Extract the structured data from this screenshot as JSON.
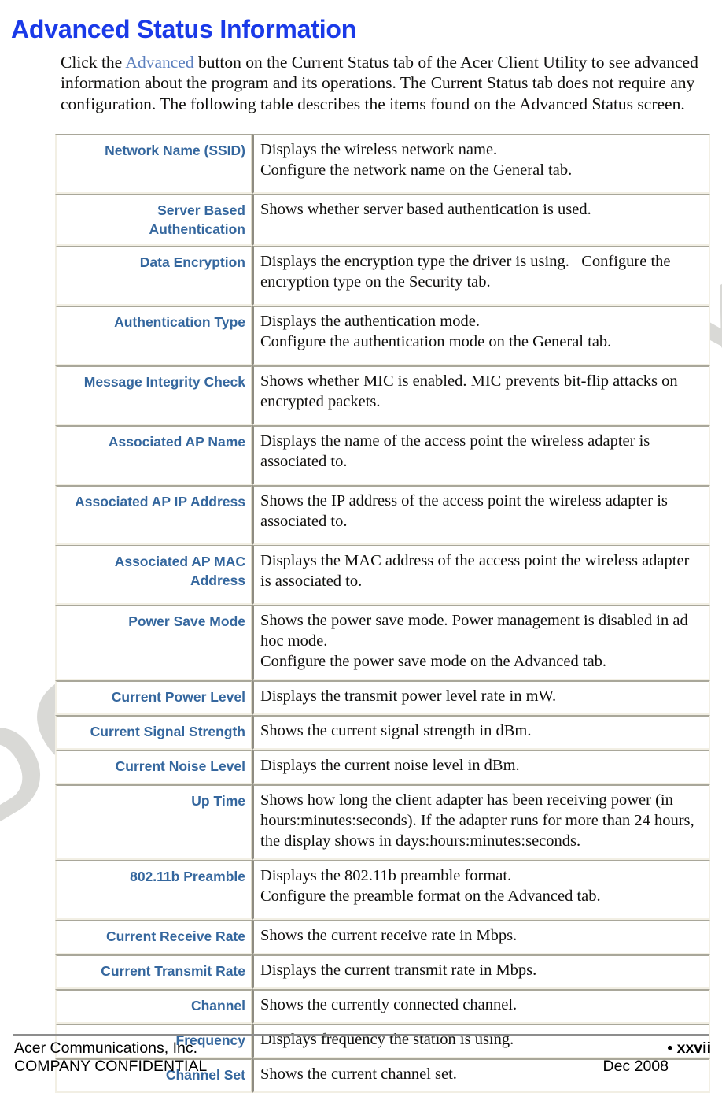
{
  "document": {
    "title": "Advanced Status Information",
    "watermark": "DO NOT COPY",
    "heading_color": "#1a3ae8",
    "label_color": "#35679e",
    "link_color": "#5b7fbe"
  },
  "intro": {
    "before_link": "Click the ",
    "link_text": "Advanced",
    "after_link": " button on the Current Status tab of the Acer Client Utility to see advanced information about the program and its operations. The Current Status tab does not require any configuration.  The following table describes the items found on the Advanced Status screen."
  },
  "table": {
    "rows": [
      {
        "label": "Network Name (SSID)",
        "lines": [
          "Displays the wireless network name.",
          "Configure the network name on the General tab."
        ]
      },
      {
        "label": "Server Based Authentication",
        "lines": [
          "Shows whether server based authentication is used."
        ]
      },
      {
        "label": "Data Encryption",
        "lines": [
          "Displays the encryption type the driver is using.   Configure the encryption type on the Security tab."
        ]
      },
      {
        "label": "Authentication Type",
        "lines": [
          "Displays the authentication mode.",
          "Configure the authentication mode on the General tab."
        ]
      },
      {
        "label": "Message Integrity Check",
        "lines": [
          "Shows whether MIC is enabled. MIC prevents bit-flip attacks on encrypted packets."
        ]
      },
      {
        "label": "Associated AP Name",
        "lines": [
          "Displays the name of the access point the wireless adapter is associated to."
        ]
      },
      {
        "label": "Associated AP IP Address",
        "lines": [
          "Shows the IP address of the access point the wireless adapter is associated to."
        ]
      },
      {
        "label": "Associated AP MAC Address",
        "lines": [
          "Displays the MAC address of the access point the wireless adapter is associated to."
        ]
      },
      {
        "label": "Power Save Mode",
        "lines": [
          "Shows the power save mode. Power management is disabled in ad hoc mode.",
          "Configure the power save mode on the Advanced tab."
        ]
      },
      {
        "label": "Current Power Level",
        "lines": [
          "Displays the transmit power level rate in mW."
        ]
      },
      {
        "label": "Current Signal Strength",
        "lines": [
          "Shows the current signal strength in dBm."
        ]
      },
      {
        "label": "Current Noise Level",
        "lines": [
          "Displays the current noise level in dBm."
        ]
      },
      {
        "label": "Up Time",
        "lines": [
          "Shows how long the client adapter has been receiving power (in hours:minutes:seconds). If the adapter runs for more than 24 hours, the display shows in days:hours:minutes:seconds."
        ]
      },
      {
        "label": "802.11b Preamble",
        "lines": [
          "Displays the 802.11b preamble format.",
          "Configure the preamble format on the Advanced tab."
        ]
      },
      {
        "label": "Current Receive Rate",
        "lines": [
          "Shows the current receive rate in Mbps."
        ]
      },
      {
        "label": "Current Transmit Rate",
        "lines": [
          "Displays the current transmit rate in Mbps."
        ]
      },
      {
        "label": "Channel",
        "lines": [
          "Shows the currently connected channel."
        ]
      },
      {
        "label": "Frequency",
        "lines": [
          "Displays frequency the station is using."
        ]
      },
      {
        "label": "Channel Set",
        "lines": [
          "Shows the current channel set."
        ]
      }
    ]
  },
  "footer": {
    "company": "Acer Communications, Inc.",
    "confidentiality": "COMPANY CONFIDENTIAL",
    "page_number": "•  xxvii",
    "date": "Dec 2008"
  }
}
